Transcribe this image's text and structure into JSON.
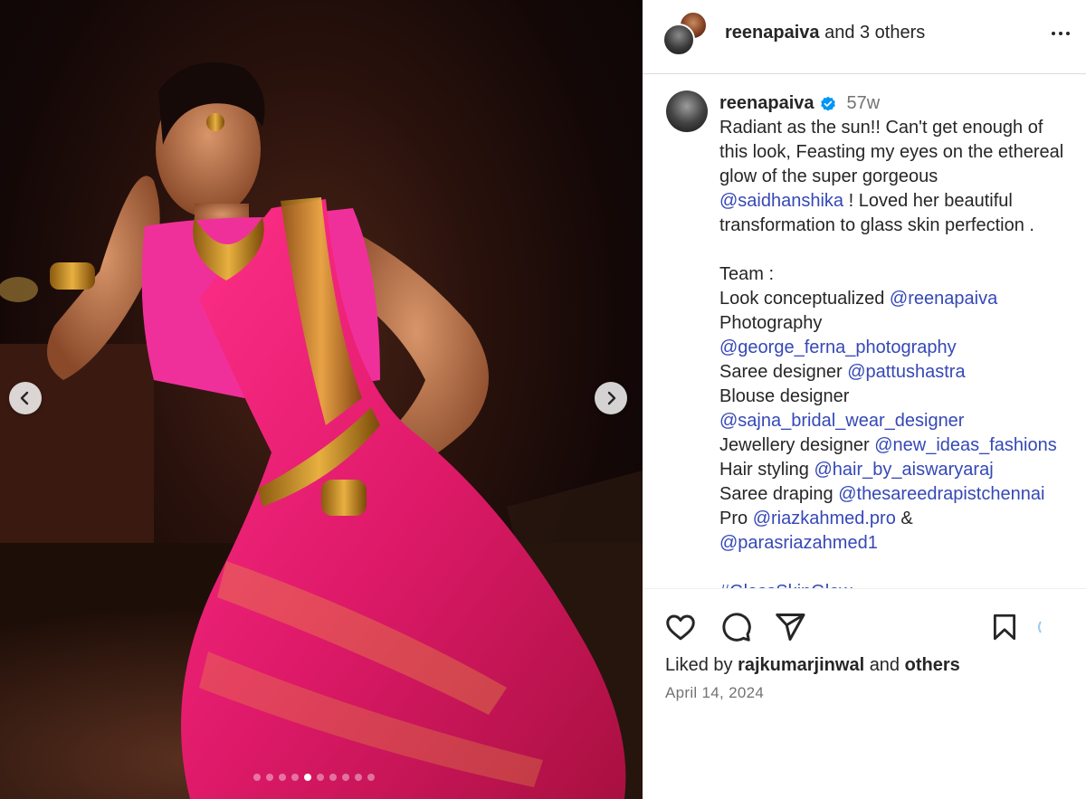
{
  "header": {
    "username": "reenapaiva",
    "others_text": "and 3 others"
  },
  "media": {
    "slide_count": 10,
    "active_slide": 5
  },
  "caption": {
    "username": "reenapaiva",
    "age": "57w",
    "lines": [
      {
        "text": "Radiant as the sun!! Can't get enough of"
      },
      {
        "text": "this look, Feasting my eyes on the ethereal"
      },
      {
        "text": "glow of the super gorgeous"
      },
      {
        "mention": "@saidhanshika",
        "text": " ! Loved her beautiful"
      },
      {
        "text": "transformation to glass skin perfection ."
      },
      {
        "text": ""
      },
      {
        "text": "Team :"
      },
      {
        "text": "Look conceptualized ",
        "mention": "@reenapaiva"
      },
      {
        "text": "Photography"
      },
      {
        "mention": "@george_ferna_photography"
      },
      {
        "text": "Saree designer ",
        "mention": "@pattushastra"
      },
      {
        "text": "Blouse designer"
      },
      {
        "mention": "@sajna_bridal_wear_designer"
      },
      {
        "text": "Jewellery designer ",
        "mention": "@new_ideas_fashions"
      },
      {
        "text": "Hair styling ",
        "mention": "@hair_by_aiswaryaraj"
      },
      {
        "text": "Saree draping ",
        "mention": "@thesareedrapistchennai"
      },
      {
        "text": "Pro ",
        "mention": "@riazkahmed.pro",
        "suffix": " &"
      },
      {
        "mention": "@parasriazahmed1"
      },
      {
        "text": ""
      },
      {
        "mention": "#GlassSkinGlow"
      }
    ]
  },
  "footer": {
    "liked_prefix": "Liked by",
    "liked_user": "rajkumarjinwal",
    "liked_and": "and",
    "liked_others": "others",
    "date": "April 14, 2024"
  },
  "colors": {
    "link": "#3548b7",
    "verified": "#0095f6",
    "muted": "#737373"
  }
}
